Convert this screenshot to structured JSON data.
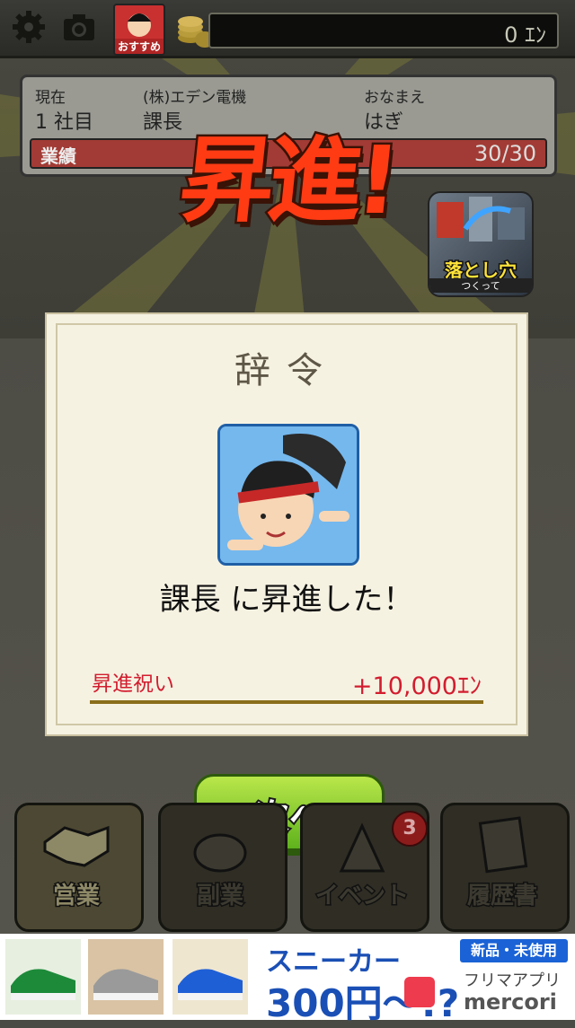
{
  "topbar": {
    "yen_balance": "0 ｴﾝ",
    "recommend_label": "おすすめ",
    "icons": [
      "gear-icon",
      "camera-icon",
      "coins-icon"
    ]
  },
  "status": {
    "current_label": "現在",
    "company": "(株)エデン電機",
    "name_label": "おなまえ",
    "company_days": "1 社目",
    "position": "課長",
    "player_name": "はぎ",
    "achievement_label": "業績",
    "achievement_value": "30/30",
    "achievement_progress": 1.0
  },
  "promotion_banner": "昇進!",
  "ad_tile": {
    "label": "落とし穴",
    "sub": "つくって"
  },
  "certificate": {
    "title": "辞令",
    "message": "課長 に昇進した！",
    "bonus_label": "昇進祝い",
    "bonus_value": "+10,000ｴﾝ"
  },
  "next_button": "次へ",
  "bottom_menu": [
    {
      "label": "営業"
    },
    {
      "label": "副業"
    },
    {
      "label": "イベント"
    },
    {
      "label": "履歴書"
    }
  ],
  "event_badge": "3",
  "ad_banner": {
    "title": "スニーカー",
    "price": "300円〜!?",
    "tag": "新品・未使用",
    "app": "フリマアプリ",
    "brand": "mercori"
  },
  "colors": {
    "accent_red": "#d21d2f",
    "button_green": "#5fb21d",
    "portrait_blue": "#74b8ee"
  }
}
